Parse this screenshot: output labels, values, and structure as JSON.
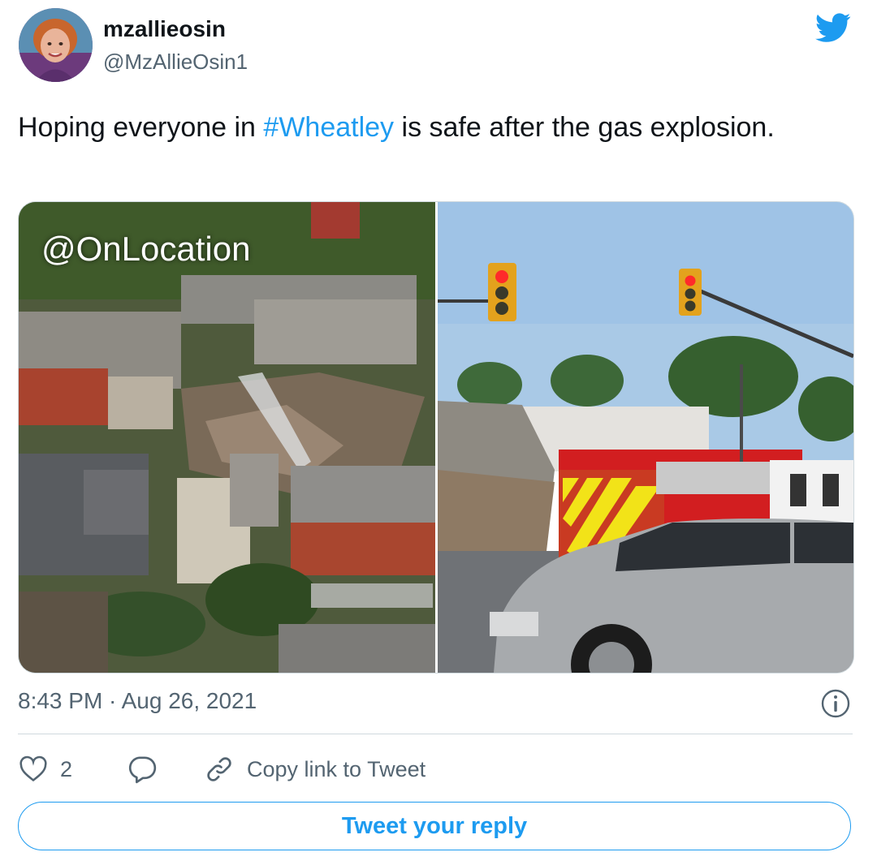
{
  "author": {
    "display_name": "mzallieosin",
    "handle": "@MzAllieOsin1"
  },
  "tweet": {
    "text_before": "Hoping everyone in ",
    "hashtag": "#Wheatley",
    "text_after": " is safe after the gas explosion.",
    "timestamp": "8:43 PM · Aug 26, 2021"
  },
  "media": {
    "left_watermark": "@OnLocation"
  },
  "actions": {
    "like_count": "2",
    "copy_link_label": "Copy link to Tweet"
  },
  "reply": {
    "button_label": "Tweet your reply"
  },
  "colors": {
    "accent": "#1d9bf0",
    "secondary_text": "#536471",
    "border": "#cfd9de"
  }
}
